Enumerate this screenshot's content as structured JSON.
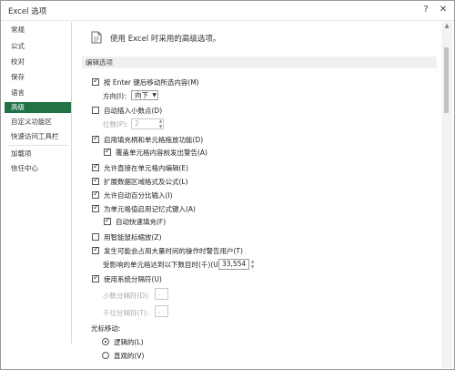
{
  "window": {
    "title": "Excel 选项",
    "help_glyph": "?",
    "close_glyph": "✕"
  },
  "sidebar": {
    "items": [
      {
        "label": "常规"
      },
      {
        "label": "公式"
      },
      {
        "label": "校对"
      },
      {
        "label": "保存"
      },
      {
        "label": "语言"
      },
      {
        "label": "高级"
      },
      {
        "label": "自定义功能区"
      },
      {
        "label": "快速访问工具栏"
      },
      {
        "label": "加载项"
      },
      {
        "label": "信任中心"
      }
    ],
    "selected": "高级"
  },
  "content": {
    "header": "使用 Excel 时采用的高级选项。",
    "section": "编辑选项",
    "options": {
      "enter_move": {
        "label": "按 Enter 键后移动所选内容(M)",
        "checked": true
      },
      "direction": {
        "label": "方向(I):",
        "value": "向下"
      },
      "auto_decimal": {
        "label": "自动插入小数点(D)",
        "checked": false
      },
      "places": {
        "label": "位数(P):",
        "value": "2"
      },
      "fill_handle": {
        "label": "启用填充柄和单元格拖放功能(D)",
        "checked": true
      },
      "overwrite_alert": {
        "label": "覆盖单元格内容前发出警告(A)",
        "checked": true
      },
      "edit_in_cell": {
        "label": "允许直接在单元格内编辑(E)",
        "checked": true
      },
      "extend_formats": {
        "label": "扩展数据区域格式及公式(L)",
        "checked": true
      },
      "auto_percent": {
        "label": "允许自动百分比输入(I)",
        "checked": true
      },
      "autocomplete": {
        "label": "为单元格值启用记忆式键入(A)",
        "checked": true
      },
      "flash_fill": {
        "label": "自动快速填充(F)",
        "checked": true
      },
      "zoom_roll": {
        "label": "用智能鼠标缩放(Z)",
        "checked": false
      },
      "slow_warn": {
        "label": "发生可能会占用大量时间的操作时警告用户(T)",
        "checked": true
      },
      "cells_affected": {
        "label": "受影响的单元格达到以下数目时(千)(U):",
        "value": "33,554"
      },
      "system_sep": {
        "label": "使用系统分隔符(U)",
        "checked": true
      },
      "decimal_sep": {
        "label": "小数分隔符(D):",
        "value": "."
      },
      "thousands_sep": {
        "label": "千位分隔符(T):",
        "value": ","
      },
      "cursor_move": {
        "label": "光标移动:"
      },
      "logical": {
        "label": "逻辑的(L)",
        "checked": true
      },
      "visual": {
        "label": "直观的(V)",
        "checked": false
      }
    }
  },
  "colors": {
    "accent": "#217346",
    "section_bg": "#f0f0f0"
  },
  "icons": {
    "page": "document-icon",
    "checkmark": "checkmark-icon",
    "dropdown": "chevron-down-icon",
    "spin": "spin-arrows-icon"
  }
}
